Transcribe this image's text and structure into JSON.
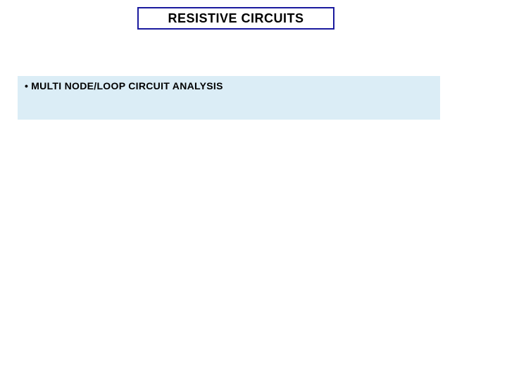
{
  "title": "RESISTIVE CIRCUITS",
  "bullet": {
    "marker": "•",
    "text": "MULTI NODE/LOOP CIRCUIT ANALYSIS"
  }
}
